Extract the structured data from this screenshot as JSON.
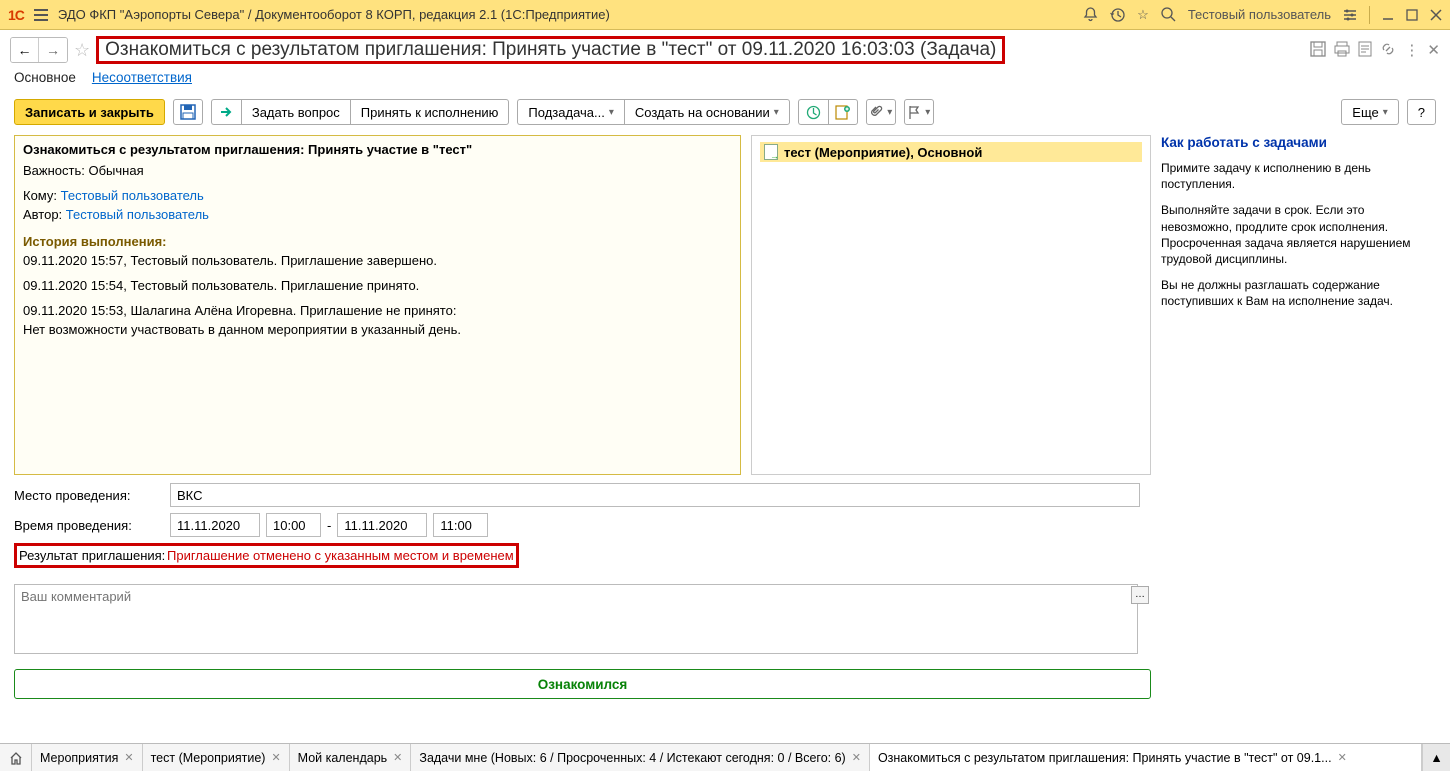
{
  "titlebar": {
    "logo": "1C",
    "app_title": "ЭДО ФКП \"Аэропорты Севера\" / Документооборот 8 КОРП, редакция 2.1  (1С:Предприятие)",
    "user": "Тестовый пользователь"
  },
  "page": {
    "title": "Ознакомиться с результатом приглашения: Принять участие в \"тест\" от 09.11.2020 16:03:03 (Задача)"
  },
  "tabs": {
    "main": "Основное",
    "nonconf": "Несоответствия"
  },
  "actions": {
    "save_close": "Записать и закрыть",
    "ask": "Задать вопрос",
    "accept": "Принять к исполнению",
    "subtask": "Подзадача...",
    "create_based": "Создать на основании",
    "more": "Еще",
    "help": "?"
  },
  "details": {
    "header": "Ознакомиться с результатом приглашения: Принять участие в \"тест\"",
    "importance_label": "Важность:",
    "importance_value": "Обычная",
    "to_label": "Кому:",
    "to_value": "Тестовый пользователь",
    "author_label": "Автор:",
    "author_value": "Тестовый пользователь",
    "history_title": "История выполнения:",
    "history": [
      "09.11.2020 15:57, Тестовый пользователь. Приглашение завершено.",
      "09.11.2020 15:54, Тестовый пользователь. Приглашение принято.",
      "09.11.2020 15:53, Шалагина Алёна Игоревна. Приглашение не принято:",
      "Нет возможности участвовать в данном мероприятии в указанный день."
    ]
  },
  "attachment": {
    "name": "тест (Мероприятие), Основной"
  },
  "fields": {
    "place_label": "Место проведения:",
    "place_value": "ВКС",
    "time_label": "Время проведения:",
    "date_from": "11.11.2020",
    "time_from": "10:00",
    "dash": "-",
    "date_to": "11.11.2020",
    "time_to": "11:00",
    "result_label": "Результат приглашения:",
    "result_value": "Приглашение отменено с указанным местом и временем"
  },
  "comment_placeholder": "Ваш комментарий",
  "ack_button": "Ознакомился",
  "help": {
    "title": "Как работать с задачами",
    "p1": "Примите задачу к исполнению в день поступления.",
    "p2": "Выполняйте задачи в срок. Если это невозможно, продлите срок исполнения. Просроченная задача является нарушением трудовой дисциплины.",
    "p3": "Вы не должны разглашать содержание поступивших к Вам на исполнение задач."
  },
  "bottom_tabs": {
    "events": "Мероприятия",
    "test": "тест (Мероприятие)",
    "calendar": "Мой календарь",
    "tasks": "Задачи мне (Новых: 6 / Просроченных: 4 / Истекают сегодня: 0 / Всего: 6)",
    "current": "Ознакомиться с результатом приглашения: Принять участие в \"тест\" от 09.1..."
  }
}
